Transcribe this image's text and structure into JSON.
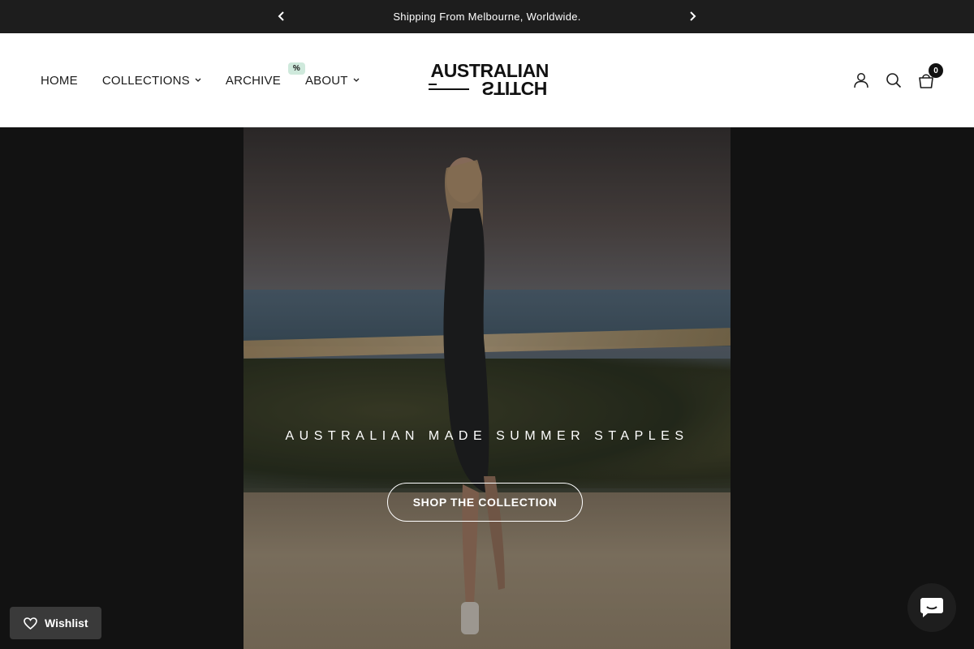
{
  "announcement": {
    "text": "Shipping From Melbourne, Worldwide."
  },
  "nav": {
    "home": "HOME",
    "collections": "COLLECTIONS",
    "archive": "ARCHIVE",
    "archive_badge": "%",
    "about": "ABOUT"
  },
  "logo": {
    "line1": "AUSTRALIAN",
    "line2": "STITCH"
  },
  "header_icons": {
    "account": "user-icon",
    "search": "search-icon",
    "cart": "bag-icon",
    "cart_count": "0"
  },
  "hero": {
    "headline": "AUSTRALIAN MADE SUMMER STAPLES",
    "button": "SHOP THE COLLECTION"
  },
  "wishlist": {
    "label": "Wishlist"
  },
  "colors": {
    "announcement_bg": "#1d1d1d",
    "page_bg": "#131313",
    "badge_bg": "#cfe9dc",
    "text_dark": "#1b1b1b"
  }
}
